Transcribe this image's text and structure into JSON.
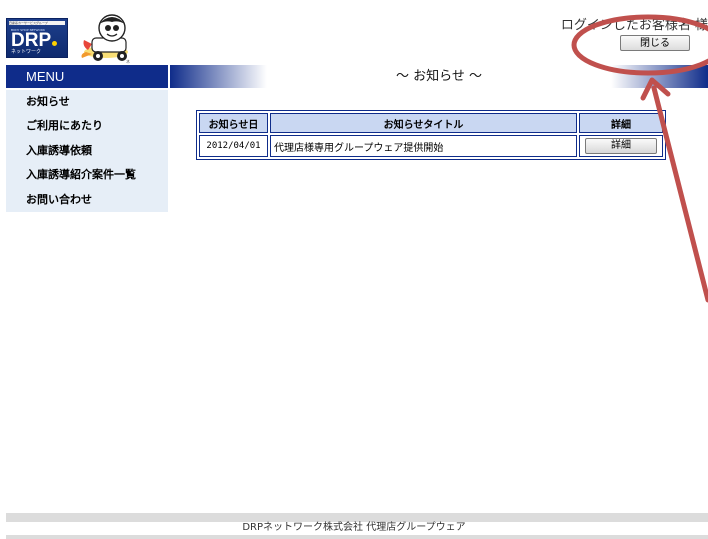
{
  "logo": {
    "small_top": "日産系カーサービスグループ",
    "small_mid": "BODY SHOP NETWORK",
    "brand": "DRP",
    "brand_sub": "ネットワーク"
  },
  "header": {
    "login_text": "ログインしたお客様名 様",
    "close_label": "閉じる"
  },
  "menu": {
    "title": "MENU",
    "items": [
      {
        "label": "お知らせ"
      },
      {
        "label": "ご利用にあたり"
      },
      {
        "label": "入庫誘導依頼"
      },
      {
        "label": "入庫誘導紹介案件一覧"
      },
      {
        "label": "お問い合わせ"
      }
    ]
  },
  "page": {
    "title": "～ お知らせ ～"
  },
  "news_table": {
    "headers": [
      "お知らせ日",
      "お知らせタイトル",
      "詳細"
    ],
    "rows": [
      {
        "date": "2012/04/01",
        "title": "代理店様専用グループウェア提供開始",
        "detail_label": "詳細"
      }
    ]
  },
  "footer": {
    "text": "DRPネットワーク株式会社  代理店グループウェア"
  },
  "colors": {
    "menu_bg": "#0f2c8a",
    "side_menu_bg": "#e6eef7",
    "table_header_bg": "#c9d7f2",
    "annotation": "#c0504d"
  }
}
